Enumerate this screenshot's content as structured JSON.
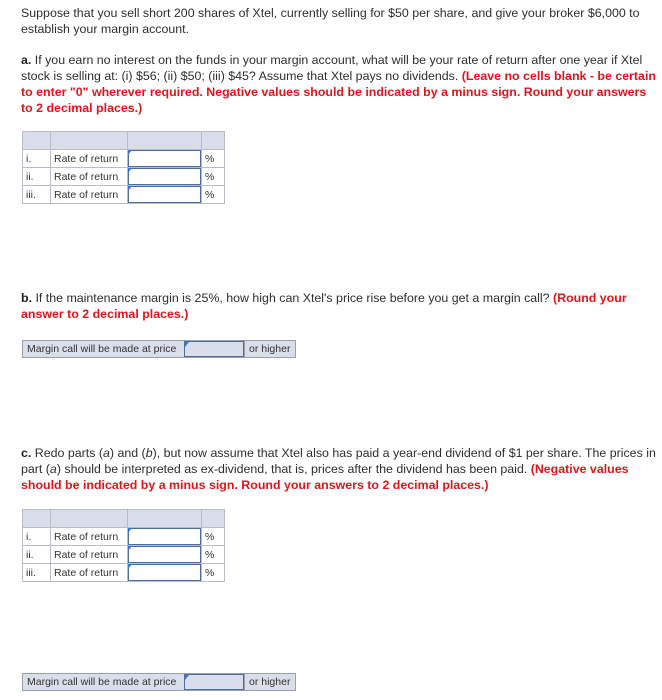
{
  "intro": {
    "text": "Suppose that you sell short 200 shares of Xtel, currently selling for $50 per share, and give your broker $6,000 to establish your margin account."
  },
  "part_a": {
    "lead": "a.",
    "text": " If you earn no interest on the funds in your margin account, what will be your rate of return after one year if Xtel stock is selling at: (i) $56; (ii) $50; (iii) $45? Assume that Xtel pays no dividends. ",
    "instruction": "(Leave no cells blank - be certain to enter \"0\" wherever required. Negative values should be indicated by a minus sign. Round your answers to 2 decimal places.)",
    "table": {
      "rows": [
        {
          "num": "i.",
          "label": "Rate of return",
          "value": "",
          "unit": "%"
        },
        {
          "num": "ii.",
          "label": "Rate of return",
          "value": "",
          "unit": "%"
        },
        {
          "num": "iii.",
          "label": "Rate of return",
          "value": "",
          "unit": "%"
        }
      ]
    }
  },
  "part_b": {
    "lead": "b.",
    "text": " If the maintenance margin is 25%, how high can Xtel's price rise before you get a margin call? ",
    "instruction": "(Round your answer to 2 decimal places.)",
    "margin_call": {
      "label": "Margin call will be made at price",
      "value": "",
      "suffix": "or higher"
    }
  },
  "part_c": {
    "lead": "c.",
    "text_1": " Redo parts (",
    "ital_a": "a",
    "text_2": ") and (",
    "ital_b": "b",
    "text_3": "), but now assume that Xtel also has paid a year-end dividend of $1 per share. The prices in part (",
    "ital_a2": "a",
    "text_4": ") should be interpreted as ex-dividend, that is, prices after the dividend has been paid. ",
    "instruction": "(Negative values should be indicated by a minus sign. Round your answers to 2 decimal places.)",
    "table": {
      "rows": [
        {
          "num": "i.",
          "label": "Rate of return",
          "value": "",
          "unit": "%"
        },
        {
          "num": "ii.",
          "label": "Rate of return",
          "value": "",
          "unit": "%"
        },
        {
          "num": "iii.",
          "label": "Rate of return",
          "value": "",
          "unit": "%"
        }
      ]
    },
    "margin_call": {
      "label": "Margin call will be made at price",
      "value": "",
      "suffix": "or higher"
    }
  },
  "colors": {
    "instruction_red": "#e0151b",
    "header_fill": "#d9dde9",
    "input_border": "#4d6e9c"
  }
}
